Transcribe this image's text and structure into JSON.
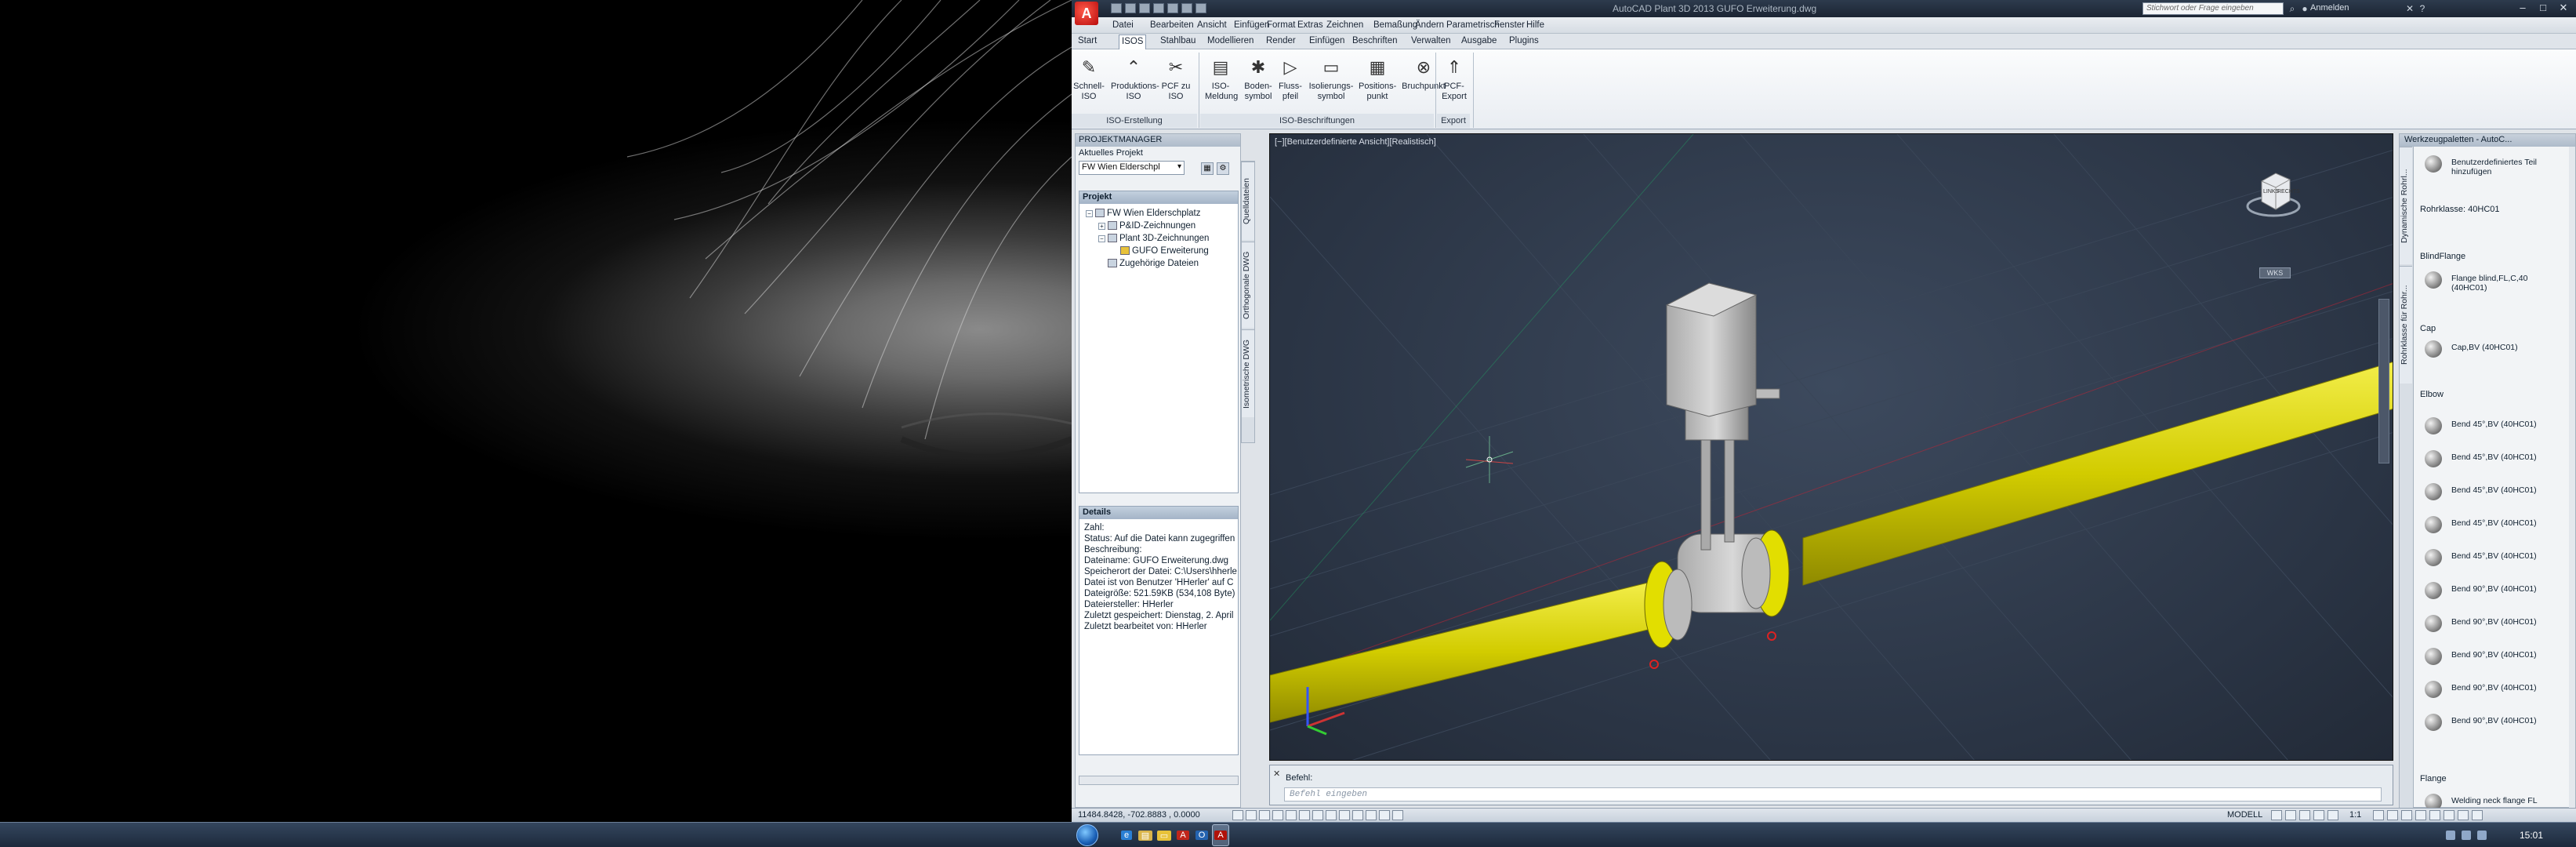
{
  "window": {
    "title": "AutoCAD Plant 3D 2013   GUFO Erweiterung.dwg",
    "search_placeholder": "Stichwort oder Frage eingeben",
    "login": "Anmelden",
    "app_letter": "A"
  },
  "menu": [
    "Datei",
    "Bearbeiten",
    "Ansicht",
    "Einfügen",
    "Format",
    "Extras",
    "Zeichnen",
    "Bemaßung",
    "Ändern",
    "Parametrisch",
    "Fenster",
    "Hilfe"
  ],
  "tabs": [
    "Start",
    "ISOS",
    "Stahlbau",
    "Modellieren",
    "Render",
    "Einfügen",
    "Beschriften",
    "Verwalten",
    "Ausgabe",
    "Plugins"
  ],
  "active_tab": "ISOS",
  "ribbon": {
    "buttons": [
      {
        "label": "Schnell-\nISO",
        "icon": "quick-iso-icon",
        "glyph": "✎"
      },
      {
        "label": "Produktions-\nISO",
        "icon": "production-iso-icon",
        "glyph": "⌃"
      },
      {
        "label": "PCF zu\nISO",
        "icon": "pcf-to-iso-icon",
        "glyph": "✂"
      },
      {
        "label": "ISO-\nMeldung",
        "icon": "iso-message-icon",
        "glyph": "▤"
      },
      {
        "label": "Boden-\nsymbol",
        "icon": "floor-symbol-icon",
        "glyph": "✱"
      },
      {
        "label": "Fluss-\npfeil",
        "icon": "flow-arrow-icon",
        "glyph": "▷"
      },
      {
        "label": "Isolierungs-\nsymbol",
        "icon": "insulation-symbol-icon",
        "glyph": "▭"
      },
      {
        "label": "Positions-\npunkt",
        "icon": "position-point-icon",
        "glyph": "▦"
      },
      {
        "label": "Bruchpunkt",
        "icon": "break-point-icon",
        "glyph": "⊗"
      },
      {
        "label": "PCF-\nExport",
        "icon": "pcf-export-icon",
        "glyph": "⇑"
      }
    ],
    "panels": [
      "ISO-Erstellung",
      "ISO-Beschriftungen",
      "Export"
    ]
  },
  "project_manager": {
    "title": "PROJEKTMANAGER",
    "current_label": "Aktuelles Projekt",
    "current_value": "FW Wien Elderschpl",
    "project_section": "Projekt",
    "tree": [
      {
        "label": "FW Wien Elderschplatz",
        "indent": 0,
        "exp": "−"
      },
      {
        "label": "P&ID-Zeichnungen",
        "indent": 1,
        "exp": "+"
      },
      {
        "label": "Plant 3D-Zeichnungen",
        "indent": 1,
        "exp": "−"
      },
      {
        "label": "GUFO Erweiterung",
        "indent": 2,
        "exp": ""
      },
      {
        "label": "Zugehörige Dateien",
        "indent": 1,
        "exp": ""
      }
    ],
    "details_section": "Details",
    "details": [
      "Zahl:",
      "Status: Auf die Datei kann zugegriffen",
      "Beschreibung:",
      "Dateiname: GUFO Erweiterung.dwg",
      "Speicherort der Datei: C:\\Users\\hherle",
      "Datei ist von Benutzer 'HHerler' auf C",
      "Dateigröße: 521.59KB (534,108 Byte)",
      "Dateiersteller: HHerler",
      "Zuletzt gespeichert: Dienstag, 2. April",
      "Zuletzt bearbeitet von: HHerler"
    ],
    "vertical_tabs": [
      "Quelldateien",
      "Orthogonale DWG",
      "Isometrische DWG"
    ]
  },
  "viewport": {
    "label": "[−][Benutzerdefinierte Ansicht][Realistisch]",
    "viewcube_left": "LINKS",
    "viewcube_right": "RECHTS",
    "wcs": "WKS"
  },
  "command": {
    "history": "Befehl:",
    "placeholder": "Befehl eingeben"
  },
  "tool_palette": {
    "title": "Werkzeugpaletten - AutoC...",
    "vertical_tabs": [
      "Dynamische Rohrl...",
      "Rohrklasse für Rohr..."
    ],
    "items": [
      {
        "type": "item",
        "text": "Benutzerdefiniertes Teil\nhinzufügen"
      },
      {
        "type": "cat",
        "text": "Rohrklasse: 40HC01"
      },
      {
        "type": "cat",
        "text": "BlindFlange"
      },
      {
        "type": "item",
        "text": "Flange blind,FL,C,40\n(40HC01)"
      },
      {
        "type": "cat",
        "text": "Cap"
      },
      {
        "type": "item",
        "text": "Cap,BV (40HC01)"
      },
      {
        "type": "cat",
        "text": "Elbow"
      },
      {
        "type": "item",
        "text": "Bend 45°,BV (40HC01)"
      },
      {
        "type": "item",
        "text": "Bend 45°,BV (40HC01)"
      },
      {
        "type": "item",
        "text": "Bend 45°,BV (40HC01)"
      },
      {
        "type": "item",
        "text": "Bend 45°,BV (40HC01)"
      },
      {
        "type": "item",
        "text": "Bend 45°,BV (40HC01)"
      },
      {
        "type": "item",
        "text": "Bend 90°,BV (40HC01)"
      },
      {
        "type": "item",
        "text": "Bend 90°,BV (40HC01)"
      },
      {
        "type": "item",
        "text": "Bend 90°,BV (40HC01)"
      },
      {
        "type": "item",
        "text": "Bend 90°,BV (40HC01)"
      },
      {
        "type": "item",
        "text": "Bend 90°,BV (40HC01)"
      },
      {
        "type": "cat",
        "text": "Flange"
      },
      {
        "type": "item",
        "text": "Welding neck flange FL"
      }
    ]
  },
  "status": {
    "coords": "11484.8428, -702.8883 , 0.0000",
    "model": "MODELL",
    "scale": "1:1"
  },
  "taskbar": {
    "clock": "15:01",
    "apps": [
      "ie-icon",
      "explorer-icon",
      "folder-icon",
      "acrobat-icon",
      "outlook-icon",
      "autocad-icon"
    ]
  },
  "colors": {
    "pipe": "#e6e000",
    "valve": "#c8c8c8",
    "viewport_bg": "#2f3a4b"
  }
}
